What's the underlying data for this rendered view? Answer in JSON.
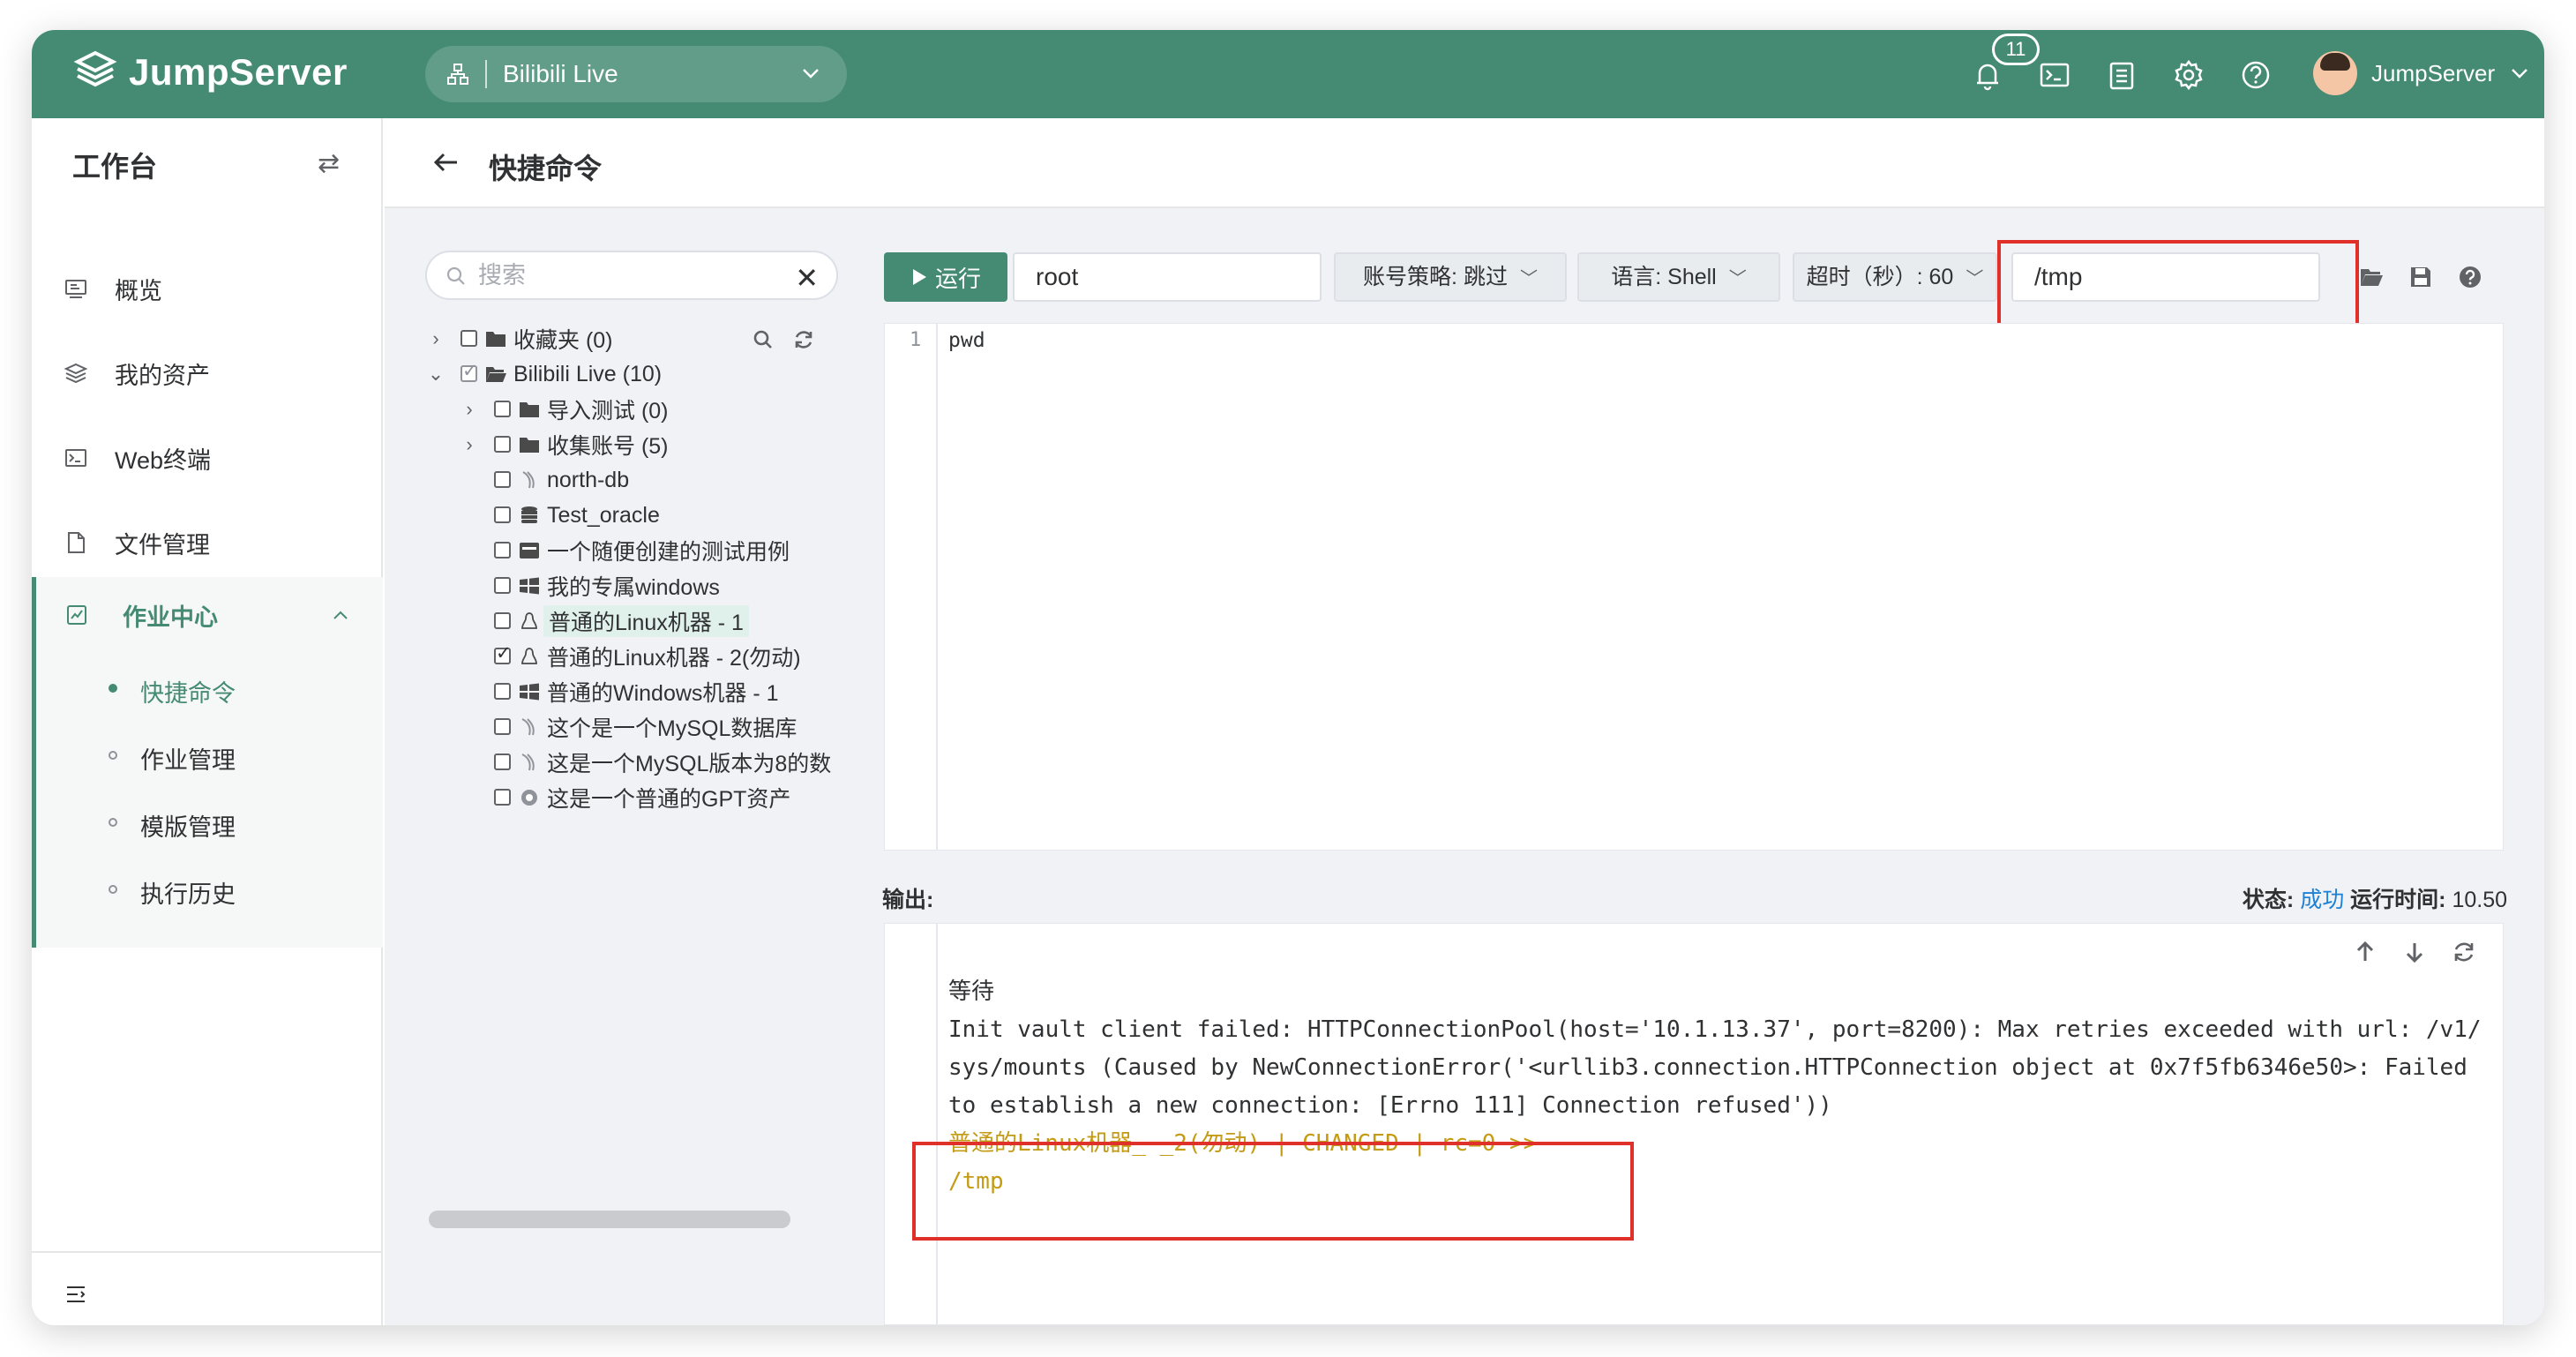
{
  "header": {
    "brand": "JumpServer",
    "org": "Bilibili Live",
    "notification_count": "11",
    "username": "JumpServer",
    "icons": [
      "bell-icon",
      "terminal-icon",
      "clipboard-icon",
      "gear-icon",
      "help-icon"
    ],
    "color": "#458b73"
  },
  "sidebar": {
    "title": "工作台",
    "items": [
      {
        "label": "概览",
        "icon": "dashboard-icon"
      },
      {
        "label": "我的资产",
        "icon": "layers-icon"
      },
      {
        "label": "Web终端",
        "icon": "terminal-icon"
      },
      {
        "label": "文件管理",
        "icon": "file-icon"
      }
    ],
    "group": {
      "label": "作业中心",
      "icon": "job-icon",
      "children": [
        {
          "label": "快捷命令",
          "active": true
        },
        {
          "label": "作业管理",
          "active": false
        },
        {
          "label": "模版管理",
          "active": false
        },
        {
          "label": "执行历史",
          "active": false
        }
      ]
    }
  },
  "page": {
    "title": "快捷命令",
    "search_placeholder": "搜索"
  },
  "tree": {
    "nodes": [
      {
        "label": "收藏夹 (0)"
      },
      {
        "label": "Bilibili Live (10)"
      },
      {
        "label": "导入测试 (0)"
      },
      {
        "label": "收集账号 (5)"
      },
      {
        "label": "north-db"
      },
      {
        "label": "Test_oracle"
      },
      {
        "label": "一个随便创建的测试用例"
      },
      {
        "label": "我的专属windows"
      },
      {
        "label": "普通的Linux机器 - 1"
      },
      {
        "label": "普通的Linux机器 - 2(勿动)"
      },
      {
        "label": "普通的Windows机器 - 1"
      },
      {
        "label": "这个是一个MySQL数据库"
      },
      {
        "label": "这是一个MySQL版本为8的数"
      },
      {
        "label": "这是一个普通的GPT资产"
      }
    ]
  },
  "toolbar": {
    "run_label": "运行",
    "user_value": "root",
    "account_policy": "账号策略: 跳过",
    "language": "语言: Shell",
    "timeout": "超时（秒）: 60",
    "workdir": "/tmp"
  },
  "editor": {
    "line_number": "1",
    "code": "pwd"
  },
  "output": {
    "label": "输出:",
    "status_label": "状态:",
    "status_value": "成功",
    "runtime_label": "运行时间:",
    "runtime_value": "10.50",
    "lines": [
      "等待",
      "Init vault client failed: HTTPConnectionPool(host='10.1.13.37', port=8200): Max retries exceeded with url: /v1/sys/mounts (Caused by NewConnectionError('<urllib3.connection.HTTPConnection object at 0x7f5fb6346e50>: Failed to establish a new connection: [Errno 111] Connection refused'))",
      "普通的Linux机器_-_2(勿动) | CHANGED | rc=0 >>",
      "/tmp"
    ],
    "highlight_color": "#c49b14"
  }
}
